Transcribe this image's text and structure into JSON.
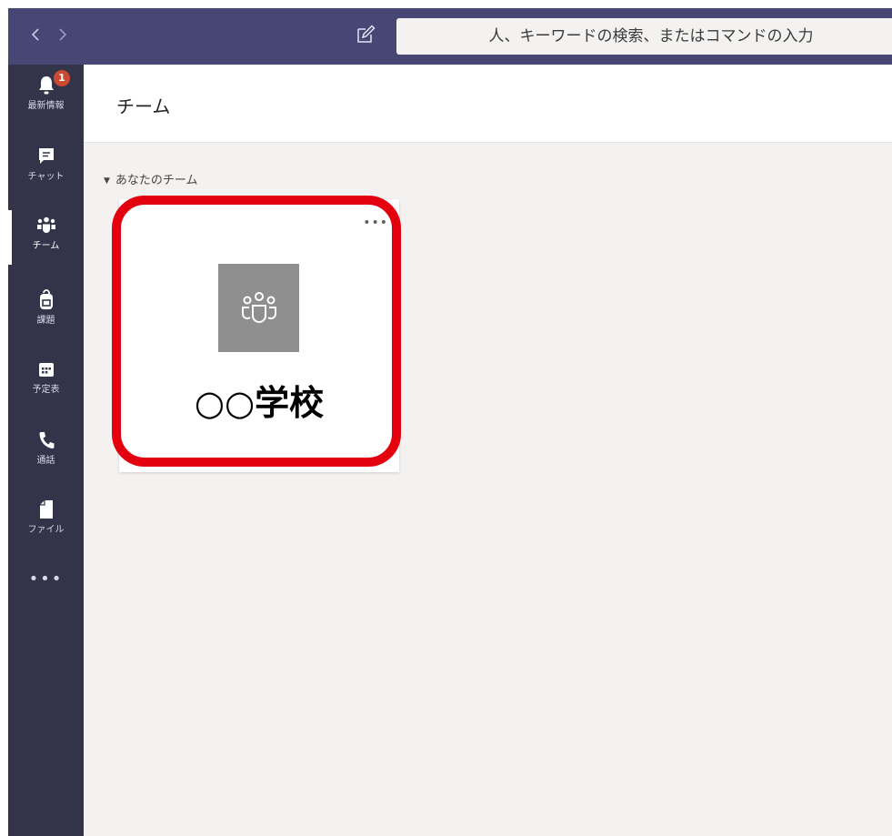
{
  "titlebar": {
    "back_icon": "chevron-left-icon",
    "forward_icon": "chevron-right-icon",
    "compose_icon": "compose-icon",
    "search_placeholder": "人、キーワードの検索、またはコマンドの入力"
  },
  "rail": {
    "items": [
      {
        "label": "最新情報",
        "icon": "bell-icon",
        "badge": "1"
      },
      {
        "label": "チャット",
        "icon": "chat-icon"
      },
      {
        "label": "チーム",
        "icon": "teams-icon"
      },
      {
        "label": "課題",
        "icon": "backpack-icon"
      },
      {
        "label": "予定表",
        "icon": "calendar-icon"
      },
      {
        "label": "通話",
        "icon": "phone-icon"
      },
      {
        "label": "ファイル",
        "icon": "file-icon"
      }
    ],
    "more_label": "•••"
  },
  "main": {
    "title": "チーム",
    "section_label": "あなたのチーム",
    "team": {
      "name": "○○学校",
      "more": "•••",
      "avatar_icon": "team-avatar-icon"
    }
  },
  "colors": {
    "titlebar": "#464775",
    "rail": "#33344a",
    "badge": "#cc4a31",
    "highlight": "#e3000f",
    "avatar": "#8f8f8f"
  }
}
